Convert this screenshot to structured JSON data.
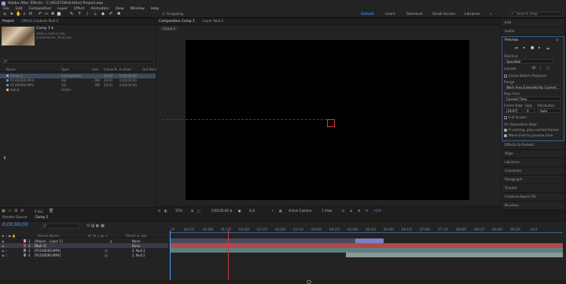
{
  "app": {
    "title": "Adobe After Effects - C:\\AE\\0728\\Untitled Project.aep"
  },
  "menu": [
    "File",
    "Edit",
    "Composition",
    "Layer",
    "Effect",
    "Animation",
    "View",
    "Window",
    "Help"
  ],
  "toolbar": {
    "snapping": "Snapping",
    "workspaces": [
      "Default",
      "Learn",
      "Standard",
      "Small Screen",
      "Libraries"
    ],
    "search_placeholder": "Search Help"
  },
  "project_panel": {
    "tabs": [
      "Project",
      "Effect Controls Null 2"
    ],
    "selected_item": {
      "name": "Comp 1 ▾",
      "info1": "3840 x 2160 (1.00)",
      "info2": "Δ 0;00;05;00, 29.97 fps"
    },
    "search_placeholder": "ρ•",
    "columns": [
      "Name",
      "Type",
      "Size",
      "Frame R...",
      "In Point",
      "Out Point"
    ],
    "items": [
      {
        "name": "Comp 1",
        "type": "Composition",
        "size": "",
        "fps": "29.97",
        "in": "0;00;00;00",
        "color": "#9999cc",
        "selected": true
      },
      {
        "name": "P1160000.MP4",
        "type": "AVI",
        "size": "...MB",
        "fps": "29.97",
        "in": "0;00;00;00",
        "color": "#5f8fb0",
        "selected": false
      },
      {
        "name": "P1160090.MP4",
        "type": "AVI",
        "size": "...MB",
        "fps": "29.97",
        "in": "0;00;00;00",
        "color": "#5f8fb0",
        "selected": false
      },
      {
        "name": "Solids",
        "type": "Folder",
        "size": "",
        "fps": "",
        "in": "",
        "color": "#d9c25a",
        "selected": false
      }
    ],
    "footer": "8 bpc"
  },
  "composition_panel": {
    "tabs": [
      "Composition Comp 1",
      "Layer Null 2"
    ],
    "breadcrumb": "Comp 1",
    "footer": {
      "zoom": "25%",
      "timecode": "0;00;05;00",
      "resolution": "Full",
      "camera": "Active Camera",
      "views": "1 View",
      "plus": "+0.0"
    }
  },
  "right_panel": {
    "info": "Info",
    "audio": "Audio",
    "preview": {
      "title": "Preview",
      "shortcut_label": "Shortcut",
      "shortcut_value": "Spacebar",
      "include_label": "Include:",
      "cache_label": "Cache Before Playback",
      "range_label": "Range",
      "range_value": "Work Area Extended By Current...",
      "playfrom_label": "Play From",
      "playfrom_value": "Current Time",
      "framerate_label": "Frame Rate",
      "skip_label": "Skip",
      "resolution_label": "Resolution",
      "framerate_value": "(29.97)",
      "skip_value": "0",
      "resolution_value": "Auto",
      "fullscreen_label": "Full Screen",
      "stop_label": "On (Spacebar) Stop:",
      "stop_opt1": "If caching, play cached frames",
      "stop_opt2": "Move time to preview time"
    },
    "items": [
      "Effects & Presets",
      "Align",
      "Libraries",
      "Character",
      "Paragraph",
      "Tracker",
      "Content-Aware Fill",
      "Brushes"
    ]
  },
  "timeline": {
    "tabs": [
      "Render Queue",
      "Comp 1"
    ],
    "timecode": "0;00;00;00",
    "search_placeholder": "ρ•",
    "col_source": "Source Name",
    "col_parent": "Parent & Link",
    "layers": [
      {
        "num": "1",
        "name": "[Adjust... Layer 1]",
        "parent": "None",
        "color": "#c8a0c8",
        "selected": false
      },
      {
        "num": "2",
        "name": "[Null 2]",
        "parent": "None",
        "color": "#c44",
        "selected": true
      },
      {
        "num": "3",
        "name": "[P1160000.MP4]",
        "parent": "2. Null 2",
        "color": "#5f8fb0",
        "selected": false
      },
      {
        "num": "4",
        "name": "[P1160090.MP4]",
        "parent": "2. Null 2",
        "color": "#5f8fb0",
        "selected": false
      }
    ],
    "ruler": [
      "0f",
      "00:15f",
      "01:00f",
      "01:15f",
      "02:00f",
      "02:15f",
      "03:00f",
      "03:15f",
      "04:00f",
      "04:15f",
      "05:00f",
      "05:15f",
      "06:00f",
      "06:15f",
      "07:00f",
      "07:15f",
      "08:00f",
      "08:15f",
      "09:00f",
      "09:15f",
      "10:0"
    ]
  }
}
